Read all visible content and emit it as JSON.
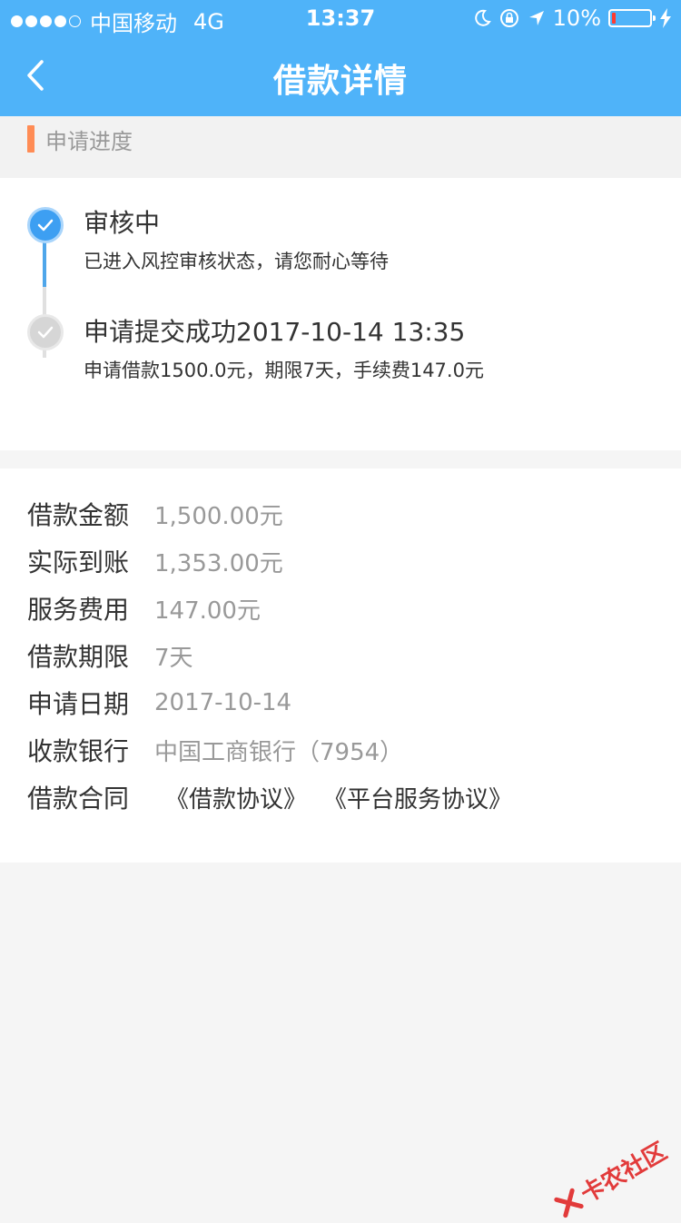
{
  "status_bar": {
    "carrier": "中国移动",
    "network": "4G",
    "time": "13:37",
    "battery": "10%",
    "battery_level": 0.1
  },
  "nav": {
    "title": "借款详情"
  },
  "progress_section": {
    "title": "申请进度",
    "steps": [
      {
        "title": "审核中",
        "desc": "已进入风控审核状态，请您耐心等待",
        "state": "active"
      },
      {
        "title": "申请提交成功2017-10-14 13:35",
        "desc": "申请借款1500.0元，期限7天，手续费147.0元",
        "state": "done"
      }
    ]
  },
  "details": {
    "rows": [
      {
        "label": "借款金额",
        "value": "1,500.00元"
      },
      {
        "label": "实际到账",
        "value": "1,353.00元"
      },
      {
        "label": "服务费用",
        "value": "147.00元"
      },
      {
        "label": "借款期限",
        "value": "7天"
      },
      {
        "label": "申请日期",
        "value": "2017-10-14"
      },
      {
        "label": "收款银行",
        "value": "中国工商银行（7954）"
      }
    ],
    "contract": {
      "label": "借款合同",
      "links": [
        "《借款协议》",
        "《平台服务协议》"
      ]
    }
  },
  "watermark": "卡农社区",
  "colors": {
    "header": "#4fb3f9",
    "accent": "#ff8c55",
    "active_step": "#3d9ff2"
  }
}
